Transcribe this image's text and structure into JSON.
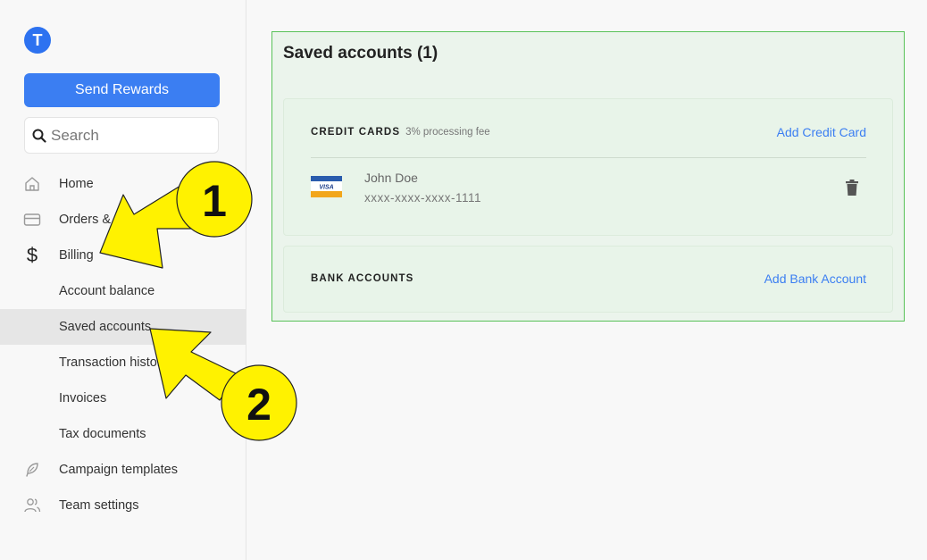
{
  "logo": {
    "letter": "T",
    "icon": "brand-logo-icon",
    "color": "#2d72f0"
  },
  "sidebar": {
    "send_label": "Send Rewards",
    "search_placeholder": "Search",
    "nav": [
      {
        "label": "Home",
        "icon": "home-icon"
      },
      {
        "label": "Orders & reports",
        "icon": "card-icon"
      },
      {
        "label": "Billing",
        "icon": "dollar-icon"
      },
      {
        "label": "Account balance"
      },
      {
        "label": "Saved accounts",
        "active": true
      },
      {
        "label": "Transaction history"
      },
      {
        "label": "Invoices"
      },
      {
        "label": "Tax documents"
      },
      {
        "label": "Campaign templates",
        "icon": "feather-icon"
      },
      {
        "label": "Team settings",
        "icon": "team-icon"
      }
    ]
  },
  "main": {
    "title": "Saved accounts (1)",
    "credit_cards": {
      "heading": "CREDIT CARDS",
      "sub": "3% processing fee",
      "add_label": "Add Credit Card",
      "cards": [
        {
          "brand": "VISA",
          "holder": "John Doe",
          "number": "xxxx-xxxx-xxxx-1111",
          "action_icon": "trash-icon"
        }
      ]
    },
    "bank_accounts": {
      "heading": "BANK ACCOUNTS",
      "add_label": "Add Bank Account"
    }
  },
  "annotations": {
    "one": "1",
    "two": "2",
    "color": "#fff200"
  }
}
